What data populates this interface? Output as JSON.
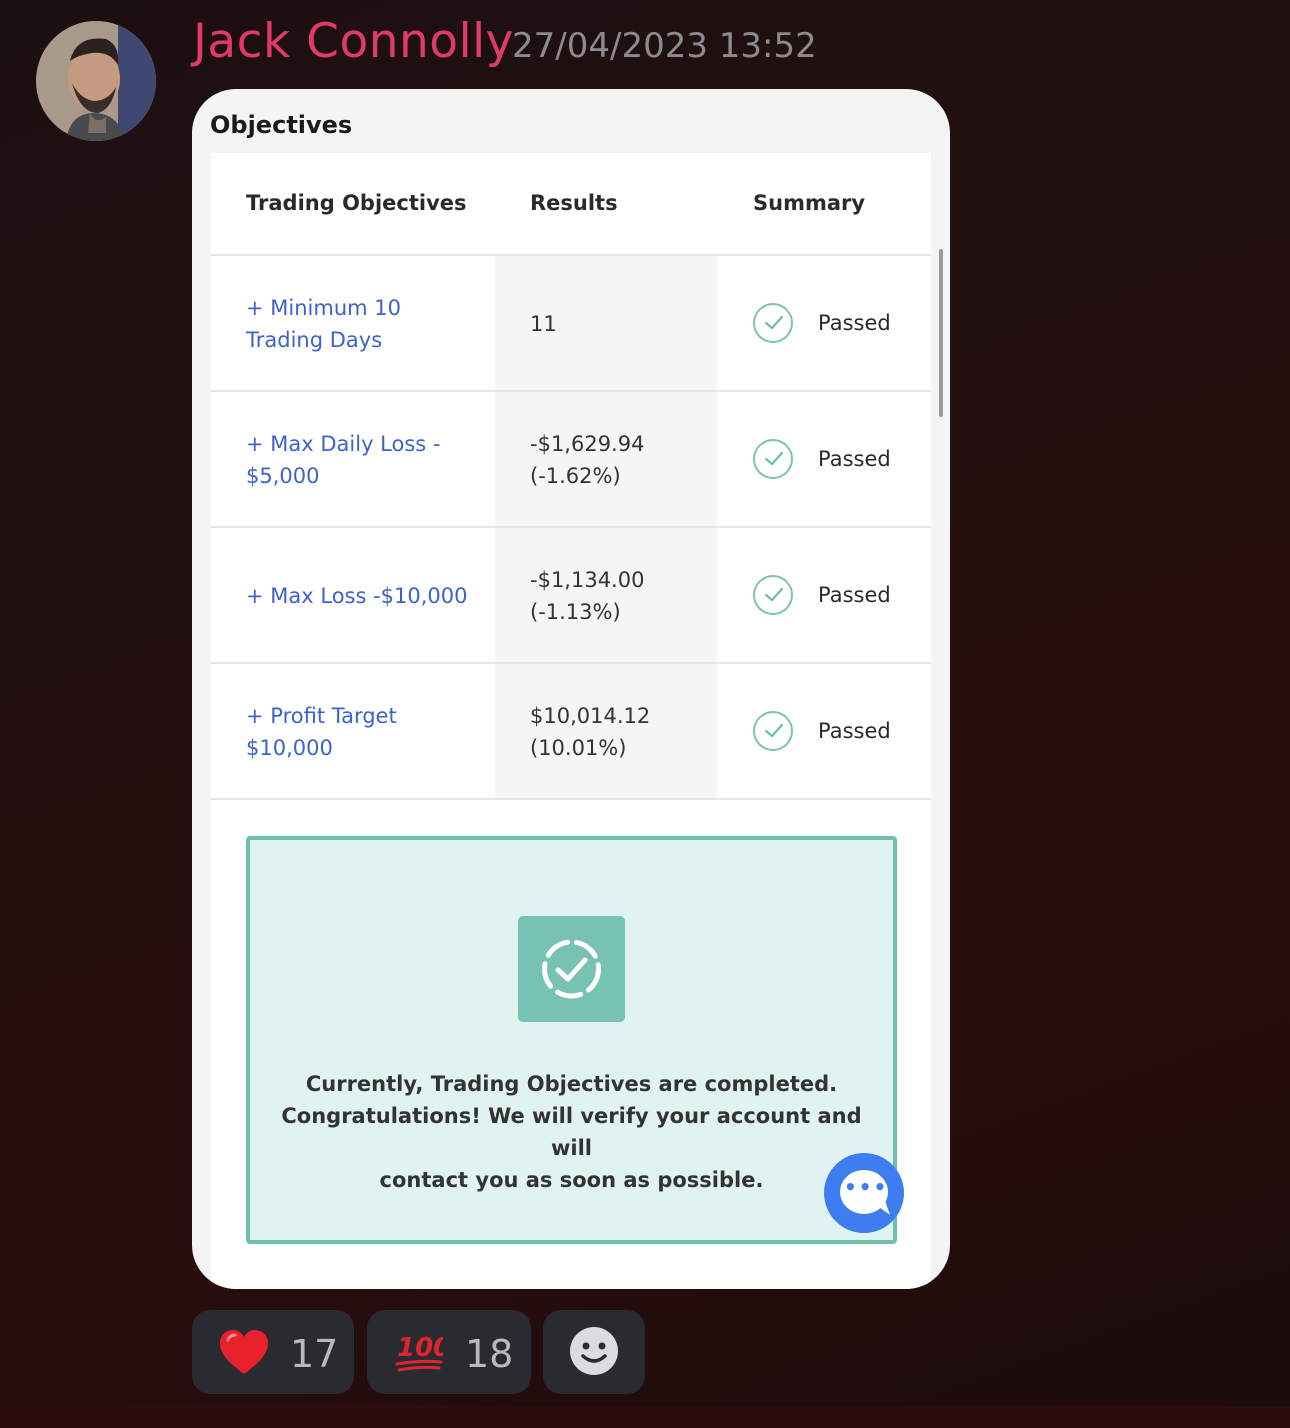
{
  "message": {
    "author": "Jack Connolly",
    "timestamp": "27/04/2023 13:52"
  },
  "card": {
    "title": "Objectives",
    "columns": [
      "Trading Objectives",
      "Results",
      "Summary"
    ],
    "rows": [
      {
        "objective_line1": "+ Minimum 10",
        "objective_line2": "Trading Days",
        "result_line1": "11",
        "result_line2": "",
        "status": "Passed"
      },
      {
        "objective_line1": "+ Max Daily Loss -",
        "objective_line2": "$5,000",
        "result_line1": "-$1,629.94",
        "result_line2": "(-1.62%)",
        "status": "Passed"
      },
      {
        "objective_line1": "+ Max Loss -$10,000",
        "objective_line2": "",
        "result_line1": "-$1,134.00",
        "result_line2": "(-1.13%)",
        "status": "Passed"
      },
      {
        "objective_line1": "+ Profit Target",
        "objective_line2": "$10,000",
        "result_line1": "$10,014.12",
        "result_line2": "(10.01%)",
        "status": "Passed"
      }
    ],
    "success": {
      "line1": "Currently, Trading Objectives are completed.",
      "line2": "Congratulations! We will verify your account and will",
      "line3": "contact you as soon as possible."
    }
  },
  "reactions": [
    {
      "emoji": "heart",
      "glyph": "❤️",
      "count": "17"
    },
    {
      "emoji": "hundred-points",
      "glyph": "100",
      "count": "18"
    },
    {
      "emoji": "add-reaction",
      "glyph": "",
      "count": ""
    }
  ],
  "colors": {
    "author": "#e03a6b",
    "link": "#3d63c9",
    "accent": "#6fbfae",
    "chat": "#3d7df0"
  }
}
